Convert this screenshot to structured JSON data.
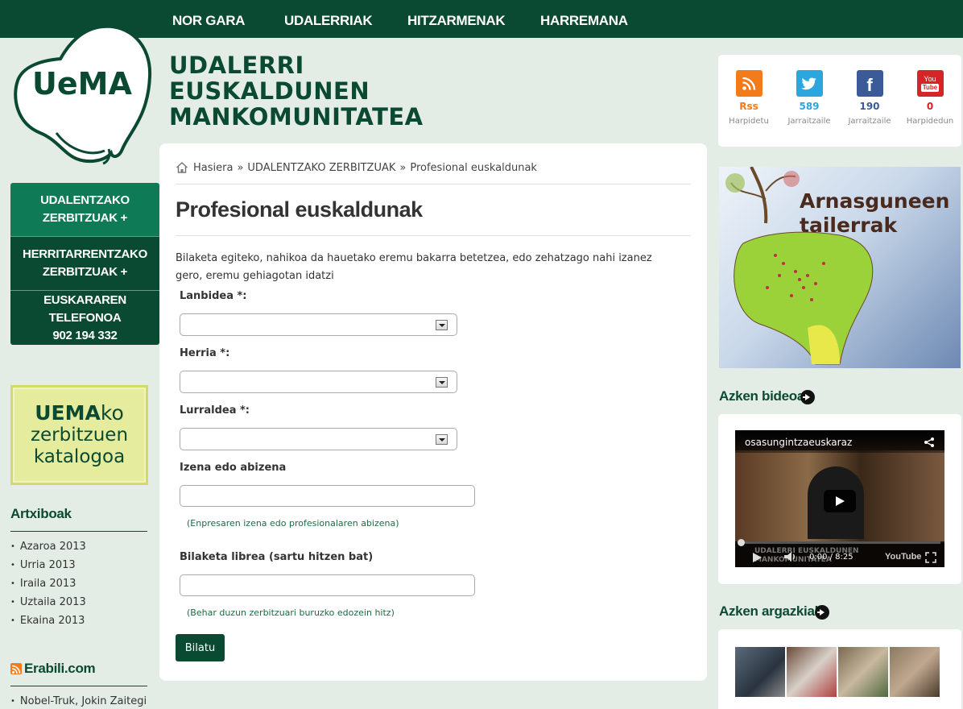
{
  "nav": {
    "items": [
      "NOR GARA",
      "UDALERRIAK",
      "HITZARMENAK",
      "HARREMANA"
    ]
  },
  "logo": {
    "text": "UeMA"
  },
  "site": {
    "title_lines": [
      "UDALERRI",
      "EUSKALDUNEN",
      "MANKOMUNITATEA"
    ]
  },
  "leftmenu": {
    "items": [
      "UDALENTZAKO\nZERBITZUAK +",
      "HERRITARRENTZAKO\nZERBITZUAK +",
      "EUSKARAREN TELEFONOA\n902 194 332"
    ]
  },
  "catalog": {
    "bold": "UEMA",
    "rest": "ko",
    "line2": "zerbitzuen",
    "line3": "katalogoa"
  },
  "archives": {
    "heading": "Artxiboak",
    "items": [
      "Azaroa 2013",
      "Urria 2013",
      "Iraila 2013",
      "Uztaila 2013",
      "Ekaina 2013"
    ]
  },
  "erabili": {
    "heading": "Erabili.com",
    "items": [
      "Nobel-Truk, Jokin Zaitegi"
    ]
  },
  "breadcrumb": {
    "home": "Hasiera",
    "sep": "»",
    "section": "UDALENTZAKO ZERBITZUAK",
    "current": "Profesional euskaldunak"
  },
  "page": {
    "title": "Profesional euskaldunak",
    "intro": "Bilaketa egiteko, nahikoa da hauetako eremu bakarra betetzea, edo zehatzago nahi izanez gero, eremu gehiagotan idatzi"
  },
  "form": {
    "lanbidea_label": "Lanbidea *:",
    "herria_label": "Herria *:",
    "lurraldea_label": "Lurraldea *:",
    "izena_label": "Izena edo abizena",
    "izena_hint": "(Enpresaren izena edo profesionalaren abizena)",
    "librea_label": "Bilaketa librea (sartu hitzen bat)",
    "librea_hint": "(Behar duzun zerbitzuari buruzko edozein hitz)",
    "submit": "Bilatu"
  },
  "social": {
    "items": [
      {
        "icon": "rss-icon",
        "count": "Rss",
        "label": "Harpidetu",
        "color": "#f27c1c"
      },
      {
        "icon": "twitter-icon",
        "count": "589",
        "label": "Jarraitzaile",
        "color": "#2ba6de"
      },
      {
        "icon": "facebook-icon",
        "count": "190",
        "label": "Jarraitzaile",
        "color": "#3a5a98"
      },
      {
        "icon": "youtube-icon",
        "count": "0",
        "label": "Harpidedun",
        "color": "#d42626"
      }
    ]
  },
  "banner": {
    "line1": "Arnasguneen",
    "line2": "tailerrak"
  },
  "video": {
    "heading": "Azken bideoa",
    "title": "osasungintzaeuskaraz",
    "time": "0:00 / 8:25",
    "watermark_line1": "UDALERRI EUSKALDUNEN",
    "watermark_line2": "MANKOMUNITATEA",
    "brand": "YouTube"
  },
  "photos": {
    "heading": "Azken argazkiak"
  },
  "colors": {
    "brand_dark": "#0b4a32",
    "brand_mid": "#0f7a56",
    "background": "#e4ece6"
  }
}
